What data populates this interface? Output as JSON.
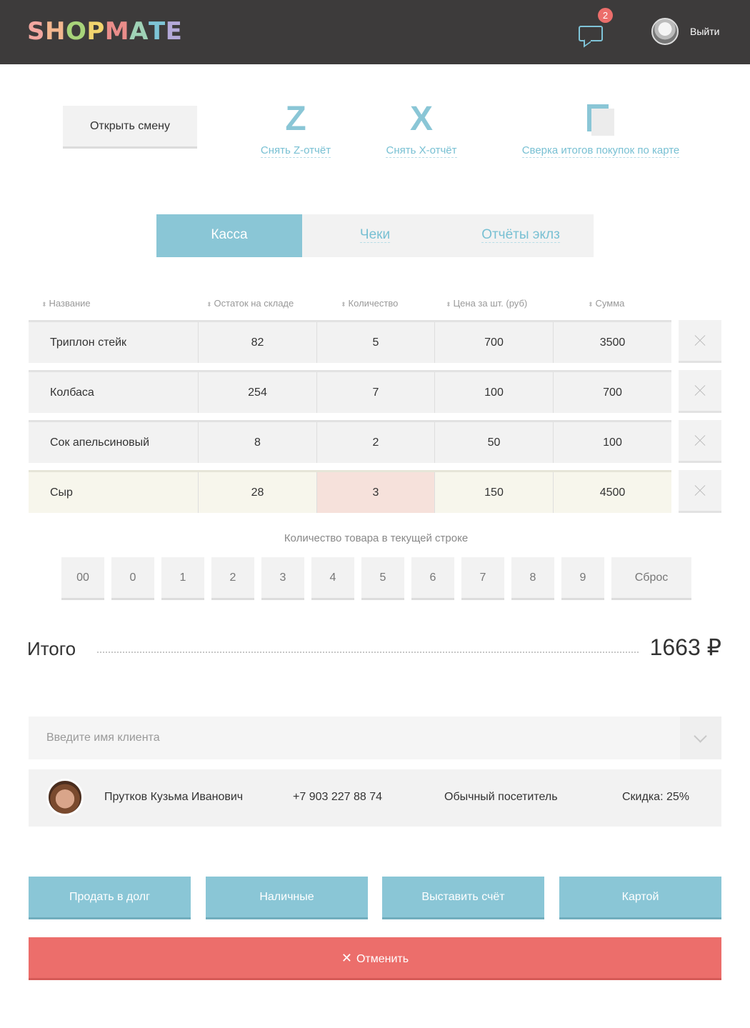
{
  "header": {
    "logo_letters": [
      "S",
      "H",
      "O",
      "P",
      "M",
      "A",
      "T",
      "E"
    ],
    "logo_colors": [
      "#f2a7a0",
      "#f3b78f",
      "#a8d47a",
      "#f2d46e",
      "#ea8d8a",
      "#9fd2b6",
      "#7ec4d6",
      "#b4a9d9"
    ],
    "messages_icon": "chat-bubble-icon",
    "notification_count": "2",
    "logout_label": "Выйти"
  },
  "toolbar": {
    "open_shift_label": "Открыть смену",
    "z_glyph": "Z",
    "z_label": "Снять Z-отчёт",
    "x_glyph": "X",
    "x_label": "Снять X-отчёт",
    "reconcile_icon": "document-icon",
    "reconcile_label": "Сверка итогов покупок по карте"
  },
  "tabs": [
    {
      "label": "Касса",
      "active": true
    },
    {
      "label": "Чеки",
      "active": false
    },
    {
      "label": "Отчёты эклз",
      "active": false
    }
  ],
  "table": {
    "headers": [
      "Название",
      "Остаток на складе",
      "Количество",
      "Цена за шт. (руб)",
      "Сумма"
    ],
    "rows": [
      {
        "name": "Триплон стейк",
        "stock": "82",
        "qty": "5",
        "price": "700",
        "sum": "3500"
      },
      {
        "name": "Колбаса",
        "stock": "254",
        "qty": "7",
        "price": "100",
        "sum": "700"
      },
      {
        "name": "Сок апельсиновый",
        "stock": "8",
        "qty": "2",
        "price": "50",
        "sum": "100"
      },
      {
        "name": "Сыр",
        "stock": "28",
        "qty": "3",
        "price": "150",
        "sum": "4500",
        "selected": true
      }
    ]
  },
  "keypad": {
    "title": "Количество товара в текущей строке",
    "keys": [
      "00",
      "0",
      "1",
      "2",
      "3",
      "4",
      "5",
      "6",
      "7",
      "8",
      "9"
    ],
    "reset_label": "Сброс"
  },
  "total": {
    "label": "Итого",
    "value": "1663 ₽"
  },
  "client": {
    "placeholder": "Введите имя клиента",
    "name": "Прутков Кузьма Иванович",
    "phone": "+7 903 227 88 74",
    "status": "Обычный посетитель",
    "discount": "Скидка: 25%"
  },
  "payment": {
    "debt_label": "Продать в долг",
    "cash_label": "Наличные",
    "invoice_label": "Выставить счёт",
    "card_label": "Картой",
    "cancel_label": "Отменить"
  },
  "colors": {
    "accent": "#8ac6d6",
    "danger": "#ec6e6b",
    "header_bg": "#3d3b3b"
  }
}
